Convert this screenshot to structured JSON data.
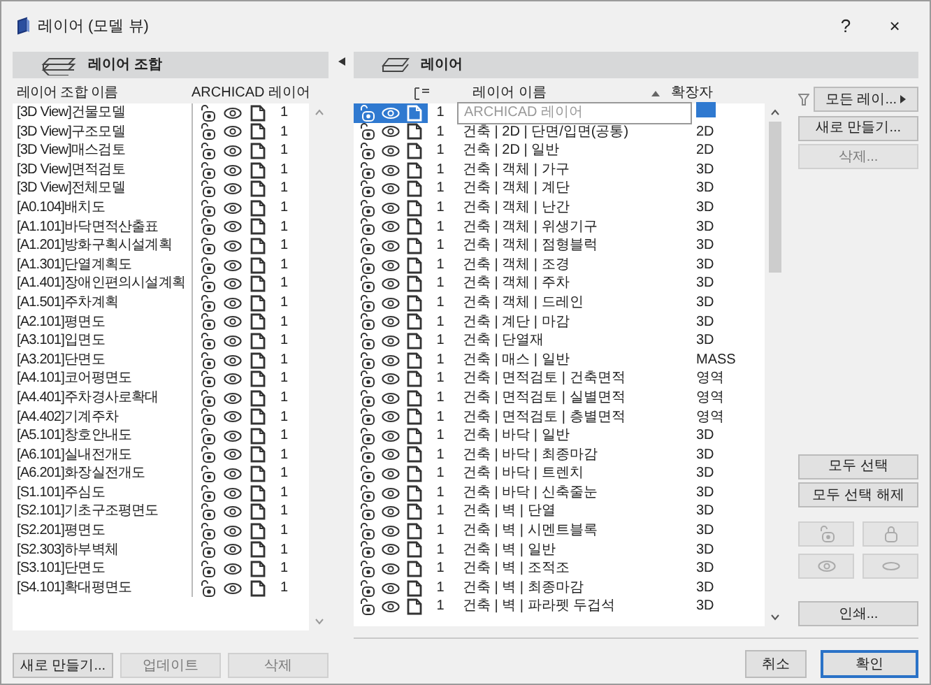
{
  "window": {
    "title": "레이어 (모델 뷰)",
    "help": "?",
    "close": "×"
  },
  "combinations": {
    "title": "레이어 조합",
    "columns": [
      "레이어 조합 이름",
      "ARCHICAD 레이어"
    ],
    "rows": [
      {
        "name": "[3D View]건물모델",
        "count": "1"
      },
      {
        "name": "[3D View]구조모델",
        "count": "1"
      },
      {
        "name": "[3D View]매스검토",
        "count": "1"
      },
      {
        "name": "[3D View]면적검토",
        "count": "1"
      },
      {
        "name": "[3D View]전체모델",
        "count": "1"
      },
      {
        "name": "[A0.104]배치도",
        "count": "1"
      },
      {
        "name": "[A1.101]바닥면적산출표",
        "count": "1"
      },
      {
        "name": "[A1.201]방화구획시설계획",
        "count": "1"
      },
      {
        "name": "[A1.301]단열계획도",
        "count": "1"
      },
      {
        "name": "[A1.401]장애인편의시설계획",
        "count": "1"
      },
      {
        "name": "[A1.501]주차계획",
        "count": "1"
      },
      {
        "name": "[A2.101]평면도",
        "count": "1"
      },
      {
        "name": "[A3.101]입면도",
        "count": "1"
      },
      {
        "name": "[A3.201]단면도",
        "count": "1"
      },
      {
        "name": "[A4.101]코어평면도",
        "count": "1"
      },
      {
        "name": "[A4.401]주차경사로확대",
        "count": "1"
      },
      {
        "name": "[A4.402]기계주차",
        "count": "1"
      },
      {
        "name": "[A5.101]창호안내도",
        "count": "1"
      },
      {
        "name": "[A6.101]실내전개도",
        "count": "1"
      },
      {
        "name": "[A6.201]화장실전개도",
        "count": "1"
      },
      {
        "name": "[S1.101]주심도",
        "count": "1"
      },
      {
        "name": "[S2.101]기초구조평면도",
        "count": "1"
      },
      {
        "name": "[S2.201]평면도",
        "count": "1"
      },
      {
        "name": "[S2.303]하부벽체",
        "count": "1"
      },
      {
        "name": "[S3.101]단면도",
        "count": "1"
      },
      {
        "name": "[S4.101]확대평면도",
        "count": "1"
      }
    ],
    "buttons": [
      {
        "label": "새로 만들기...",
        "disabled": false
      },
      {
        "label": "업데이트",
        "disabled": true
      },
      {
        "label": "삭제",
        "disabled": true
      }
    ]
  },
  "layers": {
    "title": "레이어",
    "columns": [
      "레이어 이름",
      "확장자"
    ],
    "rows": [
      {
        "number": "1",
        "name": "ARCHICAD 레이어",
        "selected": true
      },
      {
        "number": "1",
        "name": "건축 | 2D | 단면/입면(공통)",
        "extension": "2D",
        "selected": false
      },
      {
        "number": "1",
        "name": "건축 | 2D | 일반",
        "extension": "2D",
        "selected": false
      },
      {
        "number": "1",
        "name": "건축 | 객체 | 가구",
        "extension": "3D",
        "selected": false
      },
      {
        "number": "1",
        "name": "건축 | 객체 | 계단",
        "extension": "3D",
        "selected": false
      },
      {
        "number": "1",
        "name": "건축 | 객체 | 난간",
        "extension": "3D",
        "selected": false
      },
      {
        "number": "1",
        "name": "건축 | 객체 | 위생기구",
        "extension": "3D",
        "selected": false
      },
      {
        "number": "1",
        "name": "건축 | 객체 | 점형블럭",
        "extension": "3D",
        "selected": false
      },
      {
        "number": "1",
        "name": "건축 | 객체 | 조경",
        "extension": "3D",
        "selected": false
      },
      {
        "number": "1",
        "name": "건축 | 객체 | 주차",
        "extension": "3D",
        "selected": false
      },
      {
        "number": "1",
        "name": "건축 | 객체 | 드레인",
        "extension": "3D",
        "selected": false
      },
      {
        "number": "1",
        "name": "건축 | 계단 | 마감",
        "extension": "3D",
        "selected": false
      },
      {
        "number": "1",
        "name": "건축 | 단열재",
        "extension": "3D",
        "selected": false
      },
      {
        "number": "1",
        "name": "건축 | 매스 | 일반",
        "extension": "MASS",
        "selected": false
      },
      {
        "number": "1",
        "name": "건축 | 면적검토 | 건축면적",
        "extension": "영역",
        "selected": false
      },
      {
        "number": "1",
        "name": "건축 | 면적검토 | 실별면적",
        "extension": "영역",
        "selected": false
      },
      {
        "number": "1",
        "name": "건축 | 면적검토 | 층별면적",
        "extension": "영역",
        "selected": false
      },
      {
        "number": "1",
        "name": "건축 | 바닥 | 일반",
        "extension": "3D",
        "selected": false
      },
      {
        "number": "1",
        "name": "건축 | 바닥 | 최종마감",
        "extension": "3D",
        "selected": false
      },
      {
        "number": "1",
        "name": "건축 | 바닥 | 트렌치",
        "extension": "3D",
        "selected": false
      },
      {
        "number": "1",
        "name": "건축 | 바닥 | 신축줄눈",
        "extension": "3D",
        "selected": false
      },
      {
        "number": "1",
        "name": "건축 | 벽 | 단열",
        "extension": "3D",
        "selected": false
      },
      {
        "number": "1",
        "name": "건축 | 벽 | 시멘트블록",
        "extension": "3D",
        "selected": false
      },
      {
        "number": "1",
        "name": "건축 | 벽 | 일반",
        "extension": "3D",
        "selected": false
      },
      {
        "number": "1",
        "name": "건축 | 벽 | 조적조",
        "extension": "3D",
        "selected": false
      },
      {
        "number": "1",
        "name": "건축 | 벽 | 최종마감",
        "extension": "3D",
        "selected": false
      },
      {
        "number": "1",
        "name": "건축 | 벽 | 파라펫 두겁석",
        "extension": "3D",
        "selected": false
      }
    ]
  },
  "side": {
    "filter": "모든 레이...",
    "buttons": [
      {
        "label": "새로 만들기...",
        "disabled": false
      },
      {
        "label": "삭제...",
        "disabled": true
      }
    ],
    "select_buttons": [
      {
        "label": "모두 선택",
        "disabled": false
      },
      {
        "label": "모두 선택 해제",
        "disabled": false
      }
    ],
    "icon_buttons": [
      {
        "kind": "unlock",
        "disabled": true
      },
      {
        "kind": "lock",
        "disabled": true
      },
      {
        "kind": "show",
        "disabled": true
      },
      {
        "kind": "hide",
        "disabled": true
      }
    ],
    "print": {
      "label": "인쇄...",
      "disabled": false
    }
  },
  "footer": [
    {
      "label": "취소",
      "default": false
    },
    {
      "label": "확인",
      "default": true
    }
  ]
}
